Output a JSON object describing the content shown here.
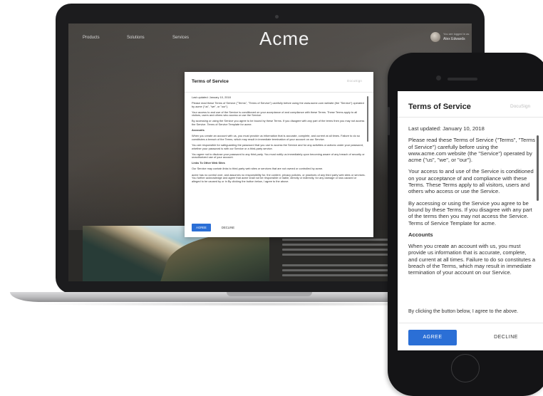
{
  "laptop": {
    "nav": [
      "Products",
      "Solutions",
      "Services"
    ],
    "brand": "Acme",
    "profile": {
      "caption": "You are logged in as",
      "name": "Alex Edwards"
    },
    "modal": {
      "title": "Terms of Service",
      "logo": "DocuSign",
      "paragraphs": [
        {
          "text": "Last updated: January 10, 2018",
          "bold": false
        },
        {
          "text": "Please read these Terms of Service (\"Terms\", \"Terms of Service\") carefully before using the www.acme.com website (the \"Service\") operated by acme (\"us\", \"we\", or \"our\").",
          "bold": false
        },
        {
          "text": "Your access to and use of the Service is conditioned on your acceptance of and compliance with these Terms. These Terms apply to all visitors, users and others who access or use the Service.",
          "bold": false
        },
        {
          "text": "By accessing or using the Service you agree to be bound by these Terms. If you disagree with any part of the terms then you may not access the Service. Terms of Service Template for acme.",
          "bold": false
        },
        {
          "text": "Accounts",
          "bold": true
        },
        {
          "text": "When you create an account with us, you must provide us information that is accurate, complete, and current at all times. Failure to do so constitutes a breach of the Terms, which may result in immediate termination of your account on our Service.",
          "bold": false
        },
        {
          "text": "You are responsible for safeguarding the password that you use to access the Service and for any activities or actions under your password, whether your password is with our Service or a third-party service.",
          "bold": false
        },
        {
          "text": "You agree not to disclose your password to any third party. You must notify us immediately upon becoming aware of any breach of security or unauthorized use of your account.",
          "bold": false
        },
        {
          "text": "Links To Other Web Sites",
          "bold": true
        },
        {
          "text": "Our Service may contain links to third-party web sites or services that are not owned or controlled by acme.",
          "bold": false
        },
        {
          "text": "acme has no control over, and assumes no responsibility for, the content, privacy policies, or practices of any third party web sites or services. You further acknowledge and agree that acme shall not be responsible or liable, directly or indirectly, for any damage or loss caused or alleged to be caused by or in By clicking the button below, I agree to the above.",
          "bold": false
        }
      ],
      "agree": "AGREE",
      "decline": "DECLINE"
    }
  },
  "phone": {
    "modal": {
      "title": "Terms of Service",
      "logo": "DocuSign",
      "paragraphs": [
        {
          "text": "Last updated: January 10, 2018",
          "bold": false
        },
        {
          "text": "Please read these Terms of Service (\"Terms\", \"Terms of Service\") carefully before using the www.acme.com website (the \"Service\") operated by acme (\"us\", \"we\", or \"our\").",
          "bold": false
        },
        {
          "text": "Your access to and use of the Service is conditioned on your acceptance of and compliance with these Terms. These Terms apply to all visitors, users and others who access or use the Service.",
          "bold": false
        },
        {
          "text": "By accessing or using the Service you agree to be bound by these Terms. If you disagree with any part of the terms then you may not access the Service. Terms of Service Template for acme.",
          "bold": false
        },
        {
          "text": "Accounts",
          "bold": true
        },
        {
          "text": "When you create an account with us, you must provide us information that is accurate, complete, and current at all times. Failure to do so constitutes a breach of the Terms, which may result in immediate termination of your account on our Service.",
          "bold": false
        }
      ],
      "footer_note": "By clicking the button below, I agree to the above.",
      "agree": "AGREE",
      "decline": "DECLINE"
    }
  },
  "colors": {
    "accent": "#2b6fd6",
    "device": "#1c1c1e"
  }
}
